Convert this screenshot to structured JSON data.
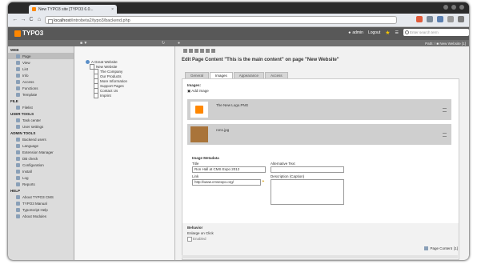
{
  "browser": {
    "tab_title": "New TYPO3 site [TYPO3 6.0...",
    "tab_close": "×",
    "url_host": "localhost",
    "url_path": "/introbeta2/typo3/backend.php",
    "nav": {
      "back": "←",
      "forward": "→",
      "reload": "C",
      "home": "⌂"
    }
  },
  "typo3": {
    "logo": "TYPO3",
    "user": "admin",
    "logout": "Logout",
    "search_placeholder": "Enter search term",
    "path_text": "Path: / ■ New Website [1]"
  },
  "module_menu": [
    {
      "section": "WEB",
      "items": [
        {
          "label": "Page",
          "active": true
        },
        {
          "label": "View"
        },
        {
          "label": "List"
        },
        {
          "label": "Info"
        },
        {
          "label": "Access"
        },
        {
          "label": "Functions"
        },
        {
          "label": "Template"
        }
      ]
    },
    {
      "section": "FILE",
      "items": [
        {
          "label": "Filelist"
        }
      ]
    },
    {
      "section": "USER TOOLS",
      "items": [
        {
          "label": "Task center"
        },
        {
          "label": "User settings"
        }
      ]
    },
    {
      "section": "ADMIN TOOLS",
      "items": [
        {
          "label": "Backend users"
        },
        {
          "label": "Language"
        },
        {
          "label": "Extension Manager"
        },
        {
          "label": "DB check"
        },
        {
          "label": "Configuration"
        },
        {
          "label": "Install"
        },
        {
          "label": "Log"
        },
        {
          "label": "Reports"
        }
      ]
    },
    {
      "section": "HELP",
      "items": [
        {
          "label": "About TYPO3 CMS"
        },
        {
          "label": "TYPO3 Manual"
        },
        {
          "label": "TypoScript Help"
        },
        {
          "label": "About Modules"
        }
      ]
    }
  ],
  "page_tree": {
    "root": "A Great Website",
    "items": [
      {
        "label": "New Website",
        "level": 1
      },
      {
        "label": "The Company",
        "level": 2
      },
      {
        "label": "Our Products",
        "level": 2
      },
      {
        "label": "More Information",
        "level": 2
      },
      {
        "label": "Support Pages",
        "level": 2
      },
      {
        "label": "Contact Us",
        "level": 2
      },
      {
        "label": "Imprint",
        "level": 2
      }
    ]
  },
  "editor": {
    "heading": "Edit Page Content \"This is the main content\" on page \"New Website\"",
    "tabs": [
      "General",
      "Images",
      "Appearance",
      "Access"
    ],
    "active_tab": "Images",
    "images_label": "Images:",
    "add_image": "Add image",
    "images": [
      {
        "name": "The New Logo.PNG"
      },
      {
        "name": "ron1.jpg"
      }
    ],
    "metadata_title": "Image Metadata",
    "title_label": "Title",
    "title_value": "Ron Hall at CMS Expo 2012",
    "alt_label": "Alternative Text",
    "alt_value": "",
    "link_label": "Link",
    "link_value": "http://www.cmsexpo.org/",
    "desc_label": "Description (Caption)",
    "behavior_label": "Behavior",
    "enlarge_label": "Enlarge on Click",
    "enabled_label": "Enabled",
    "footer_label": "Page Content",
    "footer_count": "[1]"
  }
}
